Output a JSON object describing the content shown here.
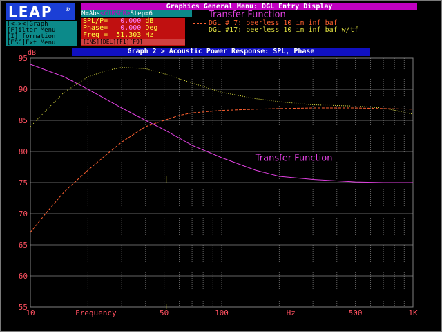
{
  "app": {
    "logo": "LEAP",
    "logo_mark": "®"
  },
  "menu": {
    "title": "Graphics General Menu: DGL Entry Display",
    "status": {
      "mode": "M=Abs",
      "cursor": "<CURSOR>",
      "step": "Step=6"
    }
  },
  "sidebar": {
    "items": [
      {
        "label": "[<-><]Graph"
      },
      {
        "label": "[F]ilter Menu"
      },
      {
        "label": "[I]nformation"
      },
      {
        "label": "[ESC]Ext Menu"
      }
    ]
  },
  "readout": {
    "spl_label": "SPL/P=",
    "spl_value": "0.000",
    "spl_unit": "dB",
    "phase_label": "Phase=",
    "phase_value": "0.000",
    "phase_unit": "Deg",
    "freq_label": "Freq =",
    "freq_value": "51.303",
    "freq_unit": "Hz",
    "keys": "[INS][DEL][F1][F9]"
  },
  "legend": [
    {
      "label": "Transfer Function",
      "color": "#e040e0"
    },
    {
      "label": "DGL # 7: peerless 10 in inf baf",
      "color": "#ff6030"
    },
    {
      "label": "DGL #17: peerless 10 in inf baf w/tf",
      "color": "#e0e040"
    }
  ],
  "graph": {
    "title": "Graph 2 > Acoustic Power Response: SPL, Phase",
    "y_unit": "dB"
  },
  "chart_data": {
    "type": "line",
    "xlabel": "Frequency",
    "x_unit": "Hz",
    "ylabel": "dB",
    "x_scale": "log",
    "xlim": [
      10,
      1000
    ],
    "ylim": [
      55,
      95
    ],
    "x_tick_labels": [
      {
        "v": 10,
        "t": "10"
      },
      {
        "v": 50,
        "t": "50"
      },
      {
        "v": 100,
        "t": "100"
      },
      {
        "v": 500,
        "t": "500"
      },
      {
        "v": 1000,
        "t": "1K"
      }
    ],
    "y_ticks": [
      55,
      60,
      65,
      70,
      75,
      80,
      85,
      90,
      95
    ],
    "grid": true,
    "cursor_freq": 51.303,
    "annotation": {
      "text": "Transfer Function",
      "x": 150,
      "y": 78.5,
      "color": "#e040e0"
    },
    "series": [
      {
        "name": "Transfer Function",
        "color": "#e040e0",
        "style": "solid",
        "x": [
          10,
          15,
          20,
          30,
          40,
          50,
          70,
          100,
          150,
          200,
          300,
          500,
          700,
          1000
        ],
        "y": [
          94,
          92,
          90,
          87,
          85,
          83.5,
          81,
          79,
          77,
          76,
          75.5,
          75.1,
          75,
          75
        ]
      },
      {
        "name": "DGL # 7: peerless 10 in inf baf",
        "color": "#ff6030",
        "style": "dash",
        "x": [
          10,
          12,
          15,
          20,
          25,
          30,
          40,
          50,
          60,
          70,
          100,
          150,
          200,
          300,
          500,
          700,
          1000
        ],
        "y": [
          67,
          70,
          73.5,
          77,
          79.5,
          81.5,
          84,
          85,
          85.8,
          86.2,
          86.6,
          86.8,
          86.9,
          87,
          87,
          86.9,
          86.8
        ]
      },
      {
        "name": "DGL #17: peerless 10 in inf baf w/tf",
        "color": "#e0e040",
        "style": "dot",
        "x": [
          10,
          12,
          15,
          20,
          25,
          30,
          40,
          50,
          70,
          100,
          150,
          200,
          300,
          500,
          700,
          1000
        ],
        "y": [
          84,
          86.5,
          89.5,
          92,
          93,
          93.5,
          93.3,
          92.5,
          91,
          89.5,
          88.5,
          88,
          87.5,
          87.3,
          87,
          86
        ]
      }
    ]
  }
}
